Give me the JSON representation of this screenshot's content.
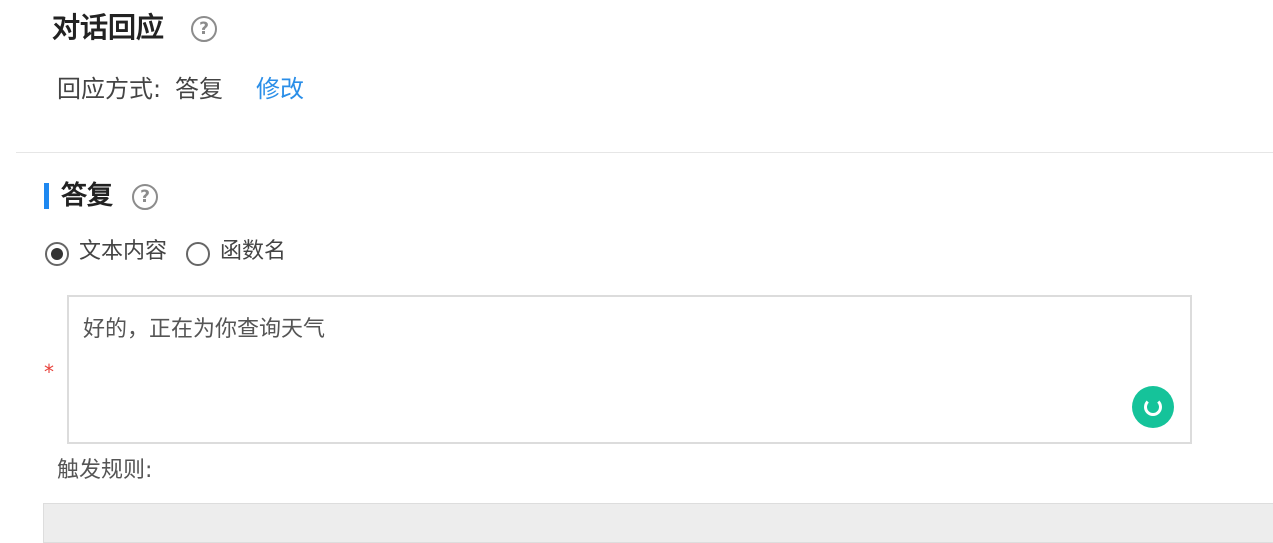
{
  "dialog_response": {
    "title": "对话回应",
    "help_symbol": "?",
    "mode_label": "回应方式:",
    "mode_value": "答复",
    "edit_link": "修改"
  },
  "reply": {
    "title": "答复",
    "help_symbol": "?",
    "options": [
      {
        "label": "文本内容",
        "selected": true
      },
      {
        "label": "函数名",
        "selected": false
      }
    ],
    "required_mark": "*",
    "text_value": "好的，正在为你查询天气"
  },
  "trigger": {
    "label": "触发规则:"
  }
}
